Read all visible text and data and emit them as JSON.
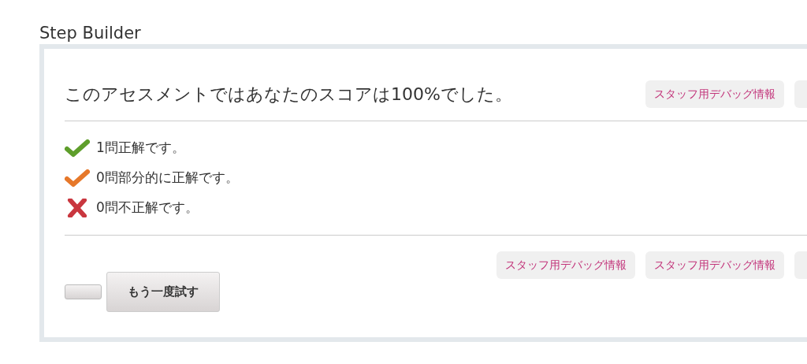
{
  "page_title": "Step Builder",
  "heading": "このアセスメントではあなたのスコアは100%でした。",
  "header_debug_buttons": [
    "スタッフ用デバッグ情報"
  ],
  "results": [
    {
      "kind": "correct",
      "text": "1問正解です。"
    },
    {
      "kind": "partial",
      "text": "0問部分的に正解です。"
    },
    {
      "kind": "incorrect",
      "text": "0問不正解です。"
    }
  ],
  "footer_debug_buttons": [
    "スタッフ用デバッグ情報",
    "スタッフ用デバッグ情報"
  ],
  "retry_button": "もう一度試す"
}
